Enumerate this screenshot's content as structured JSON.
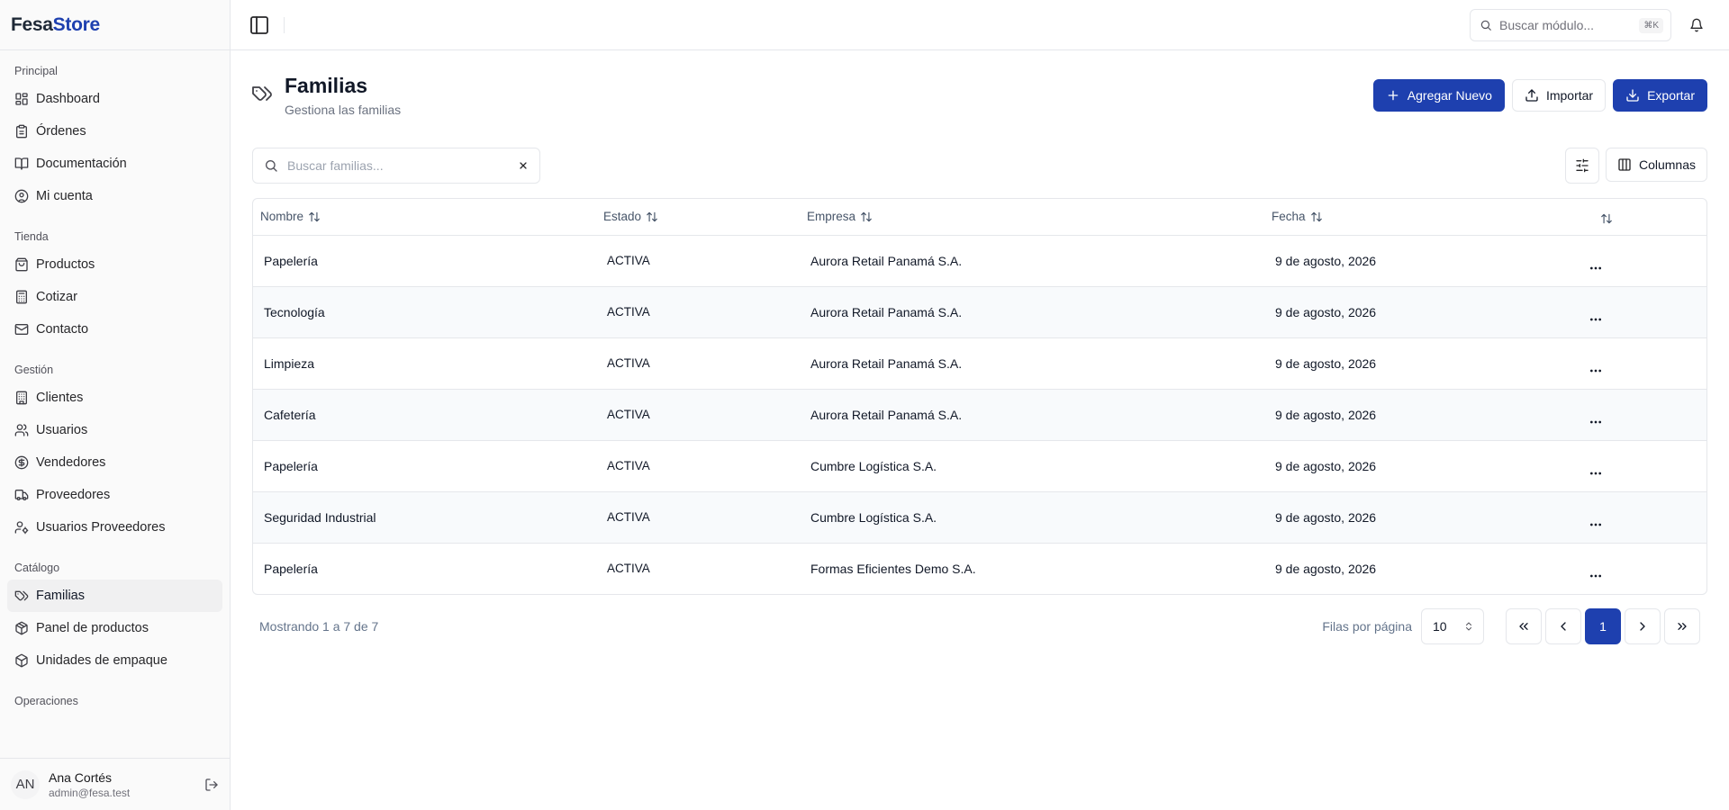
{
  "app": {
    "brand_left": "Fesa",
    "brand_right": "Store"
  },
  "topbar": {
    "search_placeholder": "Buscar módulo...",
    "shortcut": "⌘K"
  },
  "sidebar": {
    "groups": [
      {
        "heading": "Principal",
        "items": [
          {
            "label": "Dashboard",
            "icon": "dashboard-icon"
          },
          {
            "label": "Órdenes",
            "icon": "clipboard-icon"
          },
          {
            "label": "Documentación",
            "icon": "book-icon"
          },
          {
            "label": "Mi cuenta",
            "icon": "user-circle-icon"
          }
        ]
      },
      {
        "heading": "Tienda",
        "items": [
          {
            "label": "Productos",
            "icon": "shopping-bag-icon"
          },
          {
            "label": "Cotizar",
            "icon": "calculator-icon"
          },
          {
            "label": "Contacto",
            "icon": "mail-icon"
          }
        ]
      },
      {
        "heading": "Gestión",
        "items": [
          {
            "label": "Clientes",
            "icon": "building-icon"
          },
          {
            "label": "Usuarios",
            "icon": "users-icon"
          },
          {
            "label": "Vendedores",
            "icon": "dollar-circle-icon"
          },
          {
            "label": "Proveedores",
            "icon": "truck-icon"
          },
          {
            "label": "Usuarios Proveedores",
            "icon": "user-cog-icon"
          }
        ]
      },
      {
        "heading": "Catálogo",
        "items": [
          {
            "label": "Familias",
            "icon": "tags-icon",
            "active": true
          },
          {
            "label": "Panel de productos",
            "icon": "package-icon"
          },
          {
            "label": "Unidades de empaque",
            "icon": "box-icon"
          }
        ]
      },
      {
        "heading": "Operaciones",
        "items": []
      }
    ],
    "user": {
      "initials": "AN",
      "name": "Ana Cortés",
      "email": "admin@fesa.test"
    }
  },
  "page": {
    "title": "Familias",
    "subtitle": "Gestiona las familias",
    "actions": {
      "add": "Agregar Nuevo",
      "import": "Importar",
      "export": "Exportar"
    },
    "search_placeholder": "Buscar familias...",
    "columns_button": "Columnas"
  },
  "table": {
    "columns": [
      "Nombre",
      "Estado",
      "Empresa",
      "Fecha",
      ""
    ],
    "rows": [
      {
        "nombre": "Papelería",
        "estado": "ACTIVA",
        "empresa": "Aurora Retail Panamá S.A.",
        "fecha": "9 de agosto, 2026"
      },
      {
        "nombre": "Tecnología",
        "estado": "ACTIVA",
        "empresa": "Aurora Retail Panamá S.A.",
        "fecha": "9 de agosto, 2026"
      },
      {
        "nombre": "Limpieza",
        "estado": "ACTIVA",
        "empresa": "Aurora Retail Panamá S.A.",
        "fecha": "9 de agosto, 2026"
      },
      {
        "nombre": "Cafetería",
        "estado": "ACTIVA",
        "empresa": "Aurora Retail Panamá S.A.",
        "fecha": "9 de agosto, 2026"
      },
      {
        "nombre": "Papelería",
        "estado": "ACTIVA",
        "empresa": "Cumbre Logística S.A.",
        "fecha": "9 de agosto, 2026"
      },
      {
        "nombre": "Seguridad Industrial",
        "estado": "ACTIVA",
        "empresa": "Cumbre Logística S.A.",
        "fecha": "9 de agosto, 2026"
      },
      {
        "nombre": "Papelería",
        "estado": "ACTIVA",
        "empresa": "Formas Eficientes Demo S.A.",
        "fecha": "9 de agosto, 2026"
      }
    ]
  },
  "pagination": {
    "showing": "Mostrando 1 a 7 de 7",
    "rows_per_page_label": "Filas por página",
    "rows_per_page": "10",
    "current_page": "1"
  },
  "colors": {
    "accent": "#1e40af",
    "sidebar_bg": "#fafafa",
    "border": "#e5e7eb"
  }
}
